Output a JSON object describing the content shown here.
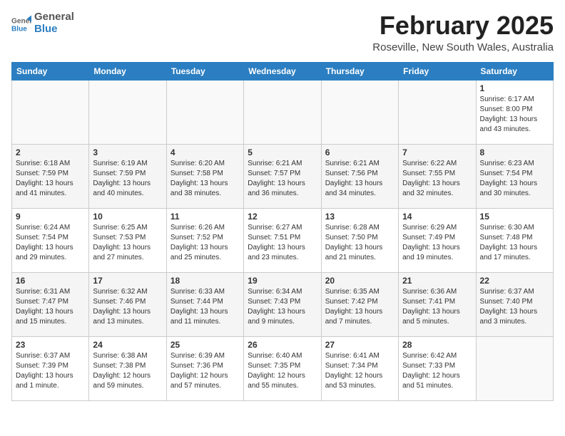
{
  "logo": {
    "line1": "General",
    "line2": "Blue"
  },
  "title": "February 2025",
  "subtitle": "Roseville, New South Wales, Australia",
  "weekdays": [
    "Sunday",
    "Monday",
    "Tuesday",
    "Wednesday",
    "Thursday",
    "Friday",
    "Saturday"
  ],
  "weeks": [
    [
      {
        "day": "",
        "info": ""
      },
      {
        "day": "",
        "info": ""
      },
      {
        "day": "",
        "info": ""
      },
      {
        "day": "",
        "info": ""
      },
      {
        "day": "",
        "info": ""
      },
      {
        "day": "",
        "info": ""
      },
      {
        "day": "1",
        "info": "Sunrise: 6:17 AM\nSunset: 8:00 PM\nDaylight: 13 hours\nand 43 minutes."
      }
    ],
    [
      {
        "day": "2",
        "info": "Sunrise: 6:18 AM\nSunset: 7:59 PM\nDaylight: 13 hours\nand 41 minutes."
      },
      {
        "day": "3",
        "info": "Sunrise: 6:19 AM\nSunset: 7:59 PM\nDaylight: 13 hours\nand 40 minutes."
      },
      {
        "day": "4",
        "info": "Sunrise: 6:20 AM\nSunset: 7:58 PM\nDaylight: 13 hours\nand 38 minutes."
      },
      {
        "day": "5",
        "info": "Sunrise: 6:21 AM\nSunset: 7:57 PM\nDaylight: 13 hours\nand 36 minutes."
      },
      {
        "day": "6",
        "info": "Sunrise: 6:21 AM\nSunset: 7:56 PM\nDaylight: 13 hours\nand 34 minutes."
      },
      {
        "day": "7",
        "info": "Sunrise: 6:22 AM\nSunset: 7:55 PM\nDaylight: 13 hours\nand 32 minutes."
      },
      {
        "day": "8",
        "info": "Sunrise: 6:23 AM\nSunset: 7:54 PM\nDaylight: 13 hours\nand 30 minutes."
      }
    ],
    [
      {
        "day": "9",
        "info": "Sunrise: 6:24 AM\nSunset: 7:54 PM\nDaylight: 13 hours\nand 29 minutes."
      },
      {
        "day": "10",
        "info": "Sunrise: 6:25 AM\nSunset: 7:53 PM\nDaylight: 13 hours\nand 27 minutes."
      },
      {
        "day": "11",
        "info": "Sunrise: 6:26 AM\nSunset: 7:52 PM\nDaylight: 13 hours\nand 25 minutes."
      },
      {
        "day": "12",
        "info": "Sunrise: 6:27 AM\nSunset: 7:51 PM\nDaylight: 13 hours\nand 23 minutes."
      },
      {
        "day": "13",
        "info": "Sunrise: 6:28 AM\nSunset: 7:50 PM\nDaylight: 13 hours\nand 21 minutes."
      },
      {
        "day": "14",
        "info": "Sunrise: 6:29 AM\nSunset: 7:49 PM\nDaylight: 13 hours\nand 19 minutes."
      },
      {
        "day": "15",
        "info": "Sunrise: 6:30 AM\nSunset: 7:48 PM\nDaylight: 13 hours\nand 17 minutes."
      }
    ],
    [
      {
        "day": "16",
        "info": "Sunrise: 6:31 AM\nSunset: 7:47 PM\nDaylight: 13 hours\nand 15 minutes."
      },
      {
        "day": "17",
        "info": "Sunrise: 6:32 AM\nSunset: 7:46 PM\nDaylight: 13 hours\nand 13 minutes."
      },
      {
        "day": "18",
        "info": "Sunrise: 6:33 AM\nSunset: 7:44 PM\nDaylight: 13 hours\nand 11 minutes."
      },
      {
        "day": "19",
        "info": "Sunrise: 6:34 AM\nSunset: 7:43 PM\nDaylight: 13 hours\nand 9 minutes."
      },
      {
        "day": "20",
        "info": "Sunrise: 6:35 AM\nSunset: 7:42 PM\nDaylight: 13 hours\nand 7 minutes."
      },
      {
        "day": "21",
        "info": "Sunrise: 6:36 AM\nSunset: 7:41 PM\nDaylight: 13 hours\nand 5 minutes."
      },
      {
        "day": "22",
        "info": "Sunrise: 6:37 AM\nSunset: 7:40 PM\nDaylight: 13 hours\nand 3 minutes."
      }
    ],
    [
      {
        "day": "23",
        "info": "Sunrise: 6:37 AM\nSunset: 7:39 PM\nDaylight: 13 hours\nand 1 minute."
      },
      {
        "day": "24",
        "info": "Sunrise: 6:38 AM\nSunset: 7:38 PM\nDaylight: 12 hours\nand 59 minutes."
      },
      {
        "day": "25",
        "info": "Sunrise: 6:39 AM\nSunset: 7:36 PM\nDaylight: 12 hours\nand 57 minutes."
      },
      {
        "day": "26",
        "info": "Sunrise: 6:40 AM\nSunset: 7:35 PM\nDaylight: 12 hours\nand 55 minutes."
      },
      {
        "day": "27",
        "info": "Sunrise: 6:41 AM\nSunset: 7:34 PM\nDaylight: 12 hours\nand 53 minutes."
      },
      {
        "day": "28",
        "info": "Sunrise: 6:42 AM\nSunset: 7:33 PM\nDaylight: 12 hours\nand 51 minutes."
      },
      {
        "day": "",
        "info": ""
      }
    ]
  ]
}
